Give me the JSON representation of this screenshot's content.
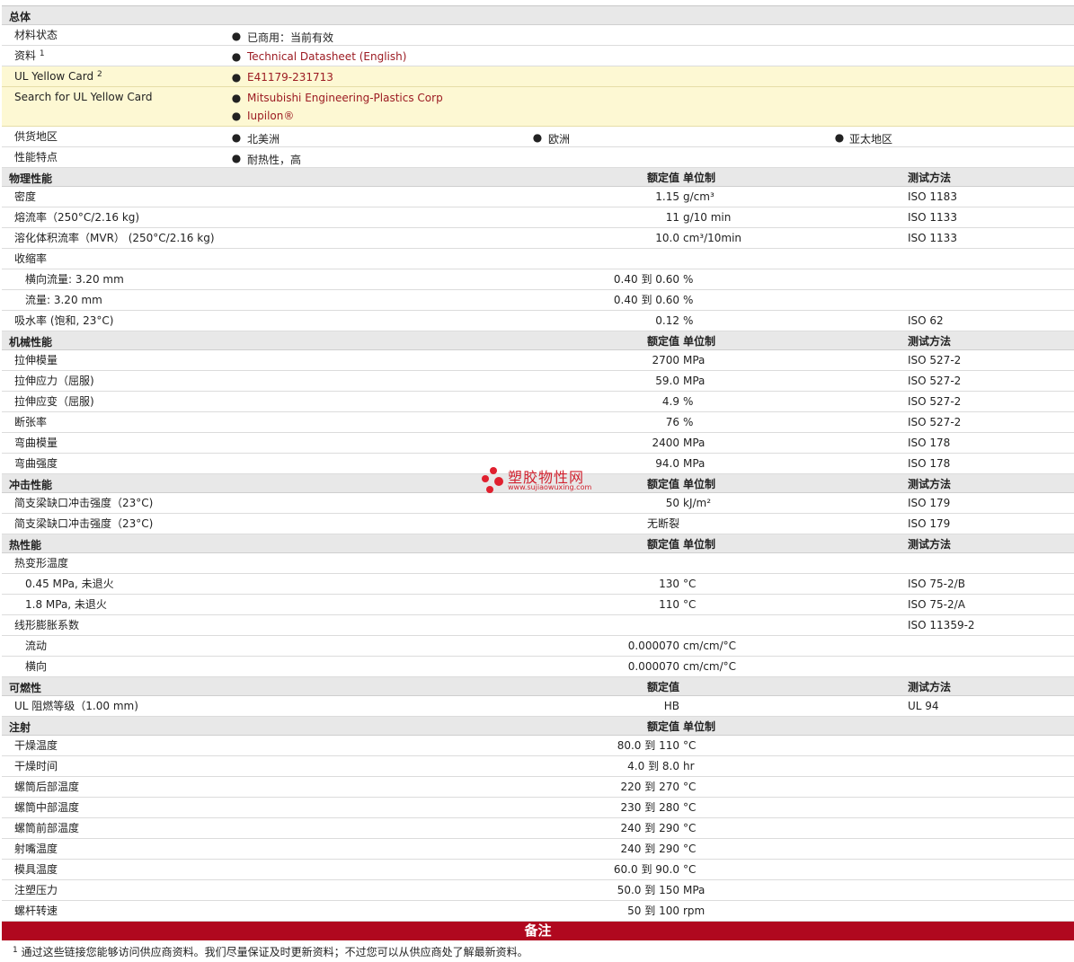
{
  "general": {
    "title": "总体",
    "status": {
      "label": "材料状态",
      "value": "已商用：当前有效"
    },
    "doc": {
      "label": "资料",
      "sup": "1",
      "link": "Technical Datasheet (English)"
    },
    "ul": {
      "label": "UL Yellow Card",
      "sup": "2",
      "link": "E41179-231713"
    },
    "search": {
      "label": "Search for UL Yellow Card",
      "links": [
        "Mitsubishi Engineering-Plastics Corp",
        "Iupilon®"
      ]
    },
    "regions": {
      "label": "供货地区",
      "values": [
        "北美洲",
        "欧洲",
        "亚太地区"
      ]
    },
    "features": {
      "label": "性能特点",
      "value": "耐热性，高"
    }
  },
  "headers": {
    "value": "额定值",
    "unit": "单位制",
    "method": "测试方法"
  },
  "to": "到",
  "physical": {
    "title": "物理性能",
    "rows": [
      {
        "label": "密度",
        "value": "1.15",
        "unit": "g/cm³",
        "method": "ISO 1183"
      },
      {
        "label": "熔流率（250°C/2.16 kg)",
        "value": "11",
        "unit": "g/10 min",
        "method": "ISO 1133"
      },
      {
        "label": "溶化体积流率（MVR） (250°C/2.16 kg)",
        "value": "10.0",
        "unit": "cm³/10min",
        "method": "ISO 1133"
      },
      {
        "label": "收缩率"
      },
      {
        "label": "横向流量: 3.20 mm",
        "sub": true,
        "v1": "0.40",
        "v2": "0.60",
        "unit": "%"
      },
      {
        "label": "流量: 3.20 mm",
        "sub": true,
        "v1": "0.40",
        "v2": "0.60",
        "unit": "%"
      },
      {
        "label": "吸水率 (饱和, 23°C)",
        "value": "0.12",
        "unit": "%",
        "method": "ISO 62"
      }
    ]
  },
  "mechanical": {
    "title": "机械性能",
    "rows": [
      {
        "label": "拉伸模量",
        "value": "2700",
        "unit": "MPa",
        "method": "ISO 527-2"
      },
      {
        "label": "拉伸应力（屈服)",
        "value": "59.0",
        "unit": "MPa",
        "method": "ISO 527-2"
      },
      {
        "label": "拉伸应变（屈服)",
        "value": "4.9",
        "unit": "%",
        "method": "ISO 527-2"
      },
      {
        "label": "断张率",
        "value": "76",
        "unit": "%",
        "method": "ISO 527-2"
      },
      {
        "label": "弯曲模量",
        "value": "2400",
        "unit": "MPa",
        "method": "ISO 178"
      },
      {
        "label": "弯曲强度",
        "value": "94.0",
        "unit": "MPa",
        "method": "ISO 178"
      }
    ]
  },
  "impact": {
    "title": "冲击性能",
    "rows": [
      {
        "label": "简支梁缺口冲击强度（23°C)",
        "value": "50",
        "unit": "kJ/m²",
        "method": "ISO 179"
      },
      {
        "label": "简支梁缺口冲击强度（23°C)",
        "value": "无断裂",
        "unit": "",
        "method": "ISO 179"
      }
    ]
  },
  "thermal": {
    "title": "热性能",
    "rows": [
      {
        "label": "热变形温度"
      },
      {
        "label": "0.45 MPa, 未退火",
        "sub": true,
        "value": "130",
        "unit": "°C",
        "method": "ISO 75-2/B"
      },
      {
        "label": "1.8 MPa, 未退火",
        "sub": true,
        "value": "110",
        "unit": "°C",
        "method": "ISO 75-2/A"
      },
      {
        "label": "线形膨胀系数",
        "method": "ISO 11359-2"
      },
      {
        "label": "流动",
        "sub": true,
        "value": "0.000070",
        "unit": "cm/cm/°C"
      },
      {
        "label": "横向",
        "sub": true,
        "value": "0.000070",
        "unit": "cm/cm/°C"
      }
    ]
  },
  "flammability": {
    "title": "可燃性",
    "rows": [
      {
        "label": "UL 阻燃等级（1.00 mm)",
        "value": "HB",
        "unit": "",
        "method": "UL 94"
      }
    ]
  },
  "injection": {
    "title": "注射",
    "rows": [
      {
        "label": "干燥温度",
        "v1": "80.0",
        "v2": "110",
        "unit": "°C"
      },
      {
        "label": "干燥时间",
        "v1": "4.0",
        "v2": "8.0",
        "unit": "hr"
      },
      {
        "label": "螺筒后部温度",
        "v1": "220",
        "v2": "270",
        "unit": "°C"
      },
      {
        "label": "螺筒中部温度",
        "v1": "230",
        "v2": "280",
        "unit": "°C"
      },
      {
        "label": "螺筒前部温度",
        "v1": "240",
        "v2": "290",
        "unit": "°C"
      },
      {
        "label": "射嘴温度",
        "v1": "240",
        "v2": "290",
        "unit": "°C"
      },
      {
        "label": "模具温度",
        "v1": "60.0",
        "v2": "90.0",
        "unit": "°C"
      },
      {
        "label": "注塑压力",
        "v1": "50.0",
        "v2": "150",
        "unit": "MPa"
      },
      {
        "label": "螺杆转速",
        "v1": "50",
        "v2": "100",
        "unit": "rpm"
      }
    ]
  },
  "notes": {
    "title": "备注",
    "items": [
      {
        "num": "1",
        "text": "通过这些链接您能够访问供应商资料。我们尽量保证及时更新资料；不过您可以从供应商处了解最新资料。"
      }
    ]
  },
  "watermark": {
    "title": "塑胶物性网",
    "url": "www.sujiaowuxing.com"
  },
  "colors": {
    "link": "#9c1b22",
    "notes_bar": "#b0081f",
    "section_bg": "#e8e8e8",
    "yellow_bg": "#fdf8d3"
  }
}
